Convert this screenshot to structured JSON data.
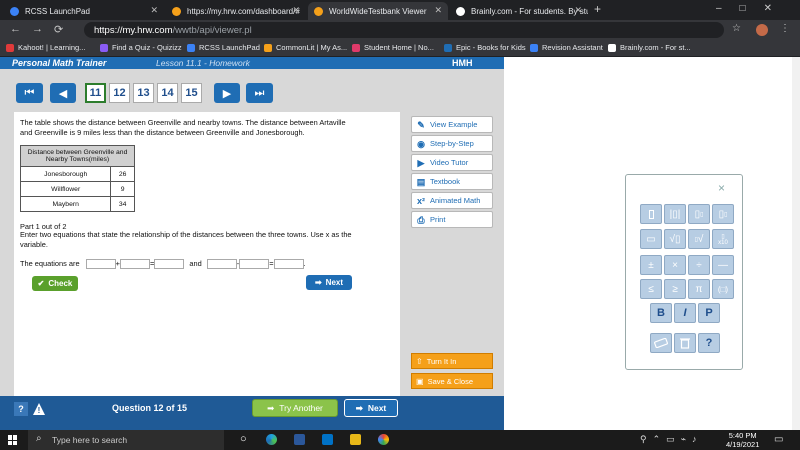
{
  "browser": {
    "tabs": [
      {
        "title": "RCSS LaunchPad",
        "favicon_color": "#3b82f6",
        "active": false
      },
      {
        "title": "https://my.hrw.com/dashboard/#",
        "favicon_color": "#f5a01a",
        "active": false
      },
      {
        "title": "WorldWideTestbank Viewer",
        "favicon_color": "#f5a01a",
        "active": true
      },
      {
        "title": "Brainly.com - For students. By stu",
        "favicon_color": "#ffffff",
        "active": false
      }
    ],
    "new_tab": "+",
    "url_host": "https://my.hrw.com",
    "url_path": "/wwtb/api/viewer.pl",
    "bookmarks": [
      {
        "label": "Kahoot! | Learning...",
        "color": "#e03a3a"
      },
      {
        "label": "Find a Quiz - Quizizz",
        "color": "#8a5cf5"
      },
      {
        "label": "RCSS LaunchPad",
        "color": "#3b82f6"
      },
      {
        "label": "CommonLit | My As...",
        "color": "#f5a01a"
      },
      {
        "label": "Student Home | No...",
        "color": "#e03a6a"
      },
      {
        "label": "Epic - Books for Kids",
        "color": "#1f6db4"
      },
      {
        "label": "Revision Assistant",
        "color": "#3b82f6"
      },
      {
        "label": "Brainly.com - For st...",
        "color": "#ffffff"
      }
    ]
  },
  "app": {
    "brand": "Personal Math Trainer",
    "lesson": "Lesson 11.1 - Homework",
    "lesson_suffix": "Homework",
    "publisher": "HMH",
    "question_numbers": [
      "11",
      "12",
      "13",
      "14",
      "15"
    ],
    "current_question": "11",
    "problem_text": "The table shows the distance between Greenville and nearby towns. The distance between Artaville and Greenville is 9 miles less than the distance between Greenville and Jonesborough.",
    "table": {
      "header": "Distance between Greenville and Nearby Towns(miles)",
      "rows": [
        {
          "town": "Jonesborough",
          "miles": "26"
        },
        {
          "town": "Willflower",
          "miles": "9"
        },
        {
          "town": "Maybern",
          "miles": "34"
        }
      ]
    },
    "part_label": "Part 1 out of 2",
    "instruction": "Enter two equations that state the relationship of the distances between the three towns. Use x  as the variable.",
    "equation_prefix": "The equations are",
    "equation_and": "and",
    "equation_end": ".",
    "op_plus": "+",
    "op_eq": "=",
    "op_minus": "-",
    "check_label": "Check",
    "next_label": "Next",
    "tools": [
      "View Example",
      "Step-by-Step",
      "Video Tutor",
      "Textbook",
      "Animated Math",
      "Print"
    ],
    "turn_in_label": "Turn It In",
    "save_close_label": "Save & Close",
    "question_counter": "Question 12 of 15",
    "try_another_label": "Try Another",
    "bottom_next_label": "Next",
    "help_label": "?",
    "warn_label": "!"
  },
  "keypad": {
    "close": "×",
    "row3": [
      "±",
      "×",
      "÷",
      "—"
    ],
    "row4": [
      "≤",
      "≥",
      "π",
      "(□)"
    ],
    "row5": [
      "B",
      "I",
      "P"
    ],
    "row6_help": "?",
    "sci_label": "x10"
  },
  "taskbar": {
    "search_placeholder": "Type here to search",
    "time": "5:40 PM",
    "date": "4/19/2021"
  }
}
